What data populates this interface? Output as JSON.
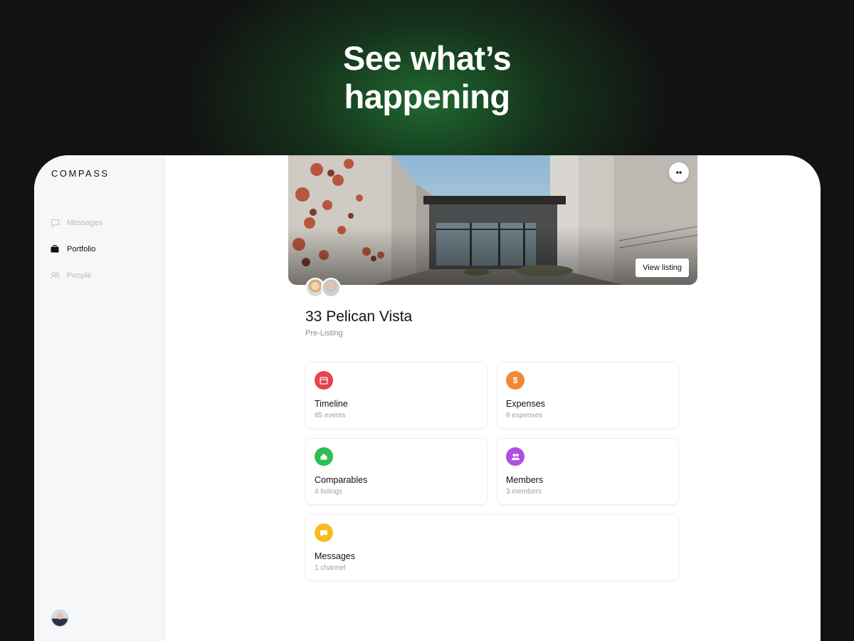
{
  "headline": {
    "line1": "See what’s",
    "line2": "happening"
  },
  "app": {
    "logo": "COMPASS",
    "nav": [
      {
        "label": "Messages",
        "icon": "chat-bubble-icon",
        "active": false
      },
      {
        "label": "Portfolio",
        "icon": "briefcase-icon",
        "active": true
      },
      {
        "label": "People",
        "icon": "people-icon",
        "active": false
      }
    ]
  },
  "property": {
    "title": "33 Pelican Vista",
    "status": "Pre-Listing",
    "view_listing": "View listing",
    "more": "••"
  },
  "cards": [
    {
      "title": "Timeline",
      "sub": "65 events",
      "icon": "calendar-icon",
      "color": "#e8424d"
    },
    {
      "title": "Expenses",
      "sub": "9 expenses",
      "icon": "dollar-icon",
      "color": "#f0883a"
    },
    {
      "title": "Comparables",
      "sub": "4 listings",
      "icon": "home-icon",
      "color": "#2bbf55"
    },
    {
      "title": "Members",
      "sub": "3 members",
      "icon": "group-icon",
      "color": "#b04ee3"
    },
    {
      "title": "Messages",
      "sub": "1 channel",
      "icon": "message-icon",
      "color": "#f5be1e"
    }
  ]
}
